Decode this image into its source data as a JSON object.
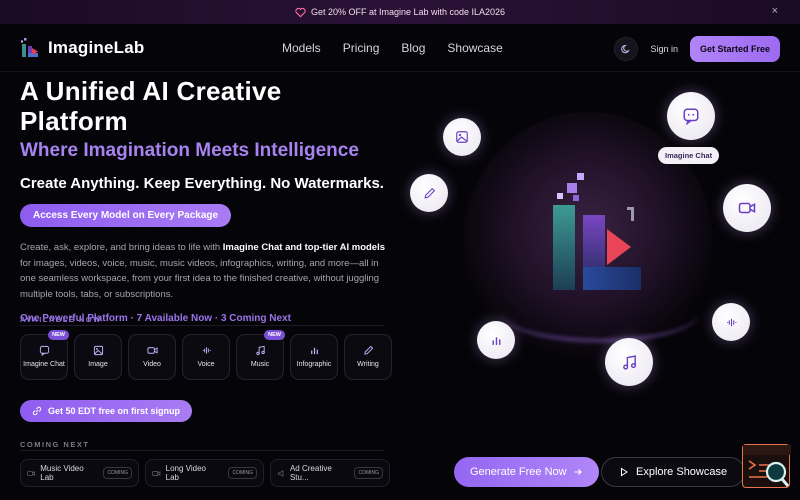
{
  "promo": {
    "text": "Get 20% OFF at Imagine Lab with code ILA2026",
    "close": "×"
  },
  "nav": {
    "logo": "ImagineLab",
    "menu": [
      "Models",
      "Pricing",
      "Blog",
      "Showcase"
    ],
    "sign_in": "Sign in",
    "get_started": "Get Started Free"
  },
  "hero": {
    "title": "A Unified AI Creative Platform",
    "subtitle": "Where Imagination Meets Intelligence",
    "tagline": "Create Anything. Keep Everything. No Watermarks.",
    "pill": "Access Every Model on Every Package",
    "desc_1": "Create, ask, explore, and bring ideas to life with ",
    "desc_bold": "Imagine Chat and top-tier AI models",
    "desc_2": " for images, videos, voice, music, music videos, infographics, writing, and more—all in one seamless workspace, from your first idea to the finished creative, without juggling multiple tools, tabs, or subscriptions.",
    "platform_line": "One Powerful Platform · 7 Available Now · 3 Coming Next"
  },
  "available": {
    "heading": "AVAILABLE NOW",
    "items": [
      {
        "label": "Imagine Chat",
        "badge": "NEW",
        "icon": "chat-icon"
      },
      {
        "label": "Image",
        "badge": "",
        "icon": "image-icon"
      },
      {
        "label": "Video",
        "badge": "",
        "icon": "video-icon"
      },
      {
        "label": "Voice",
        "badge": "",
        "icon": "voice-icon"
      },
      {
        "label": "Music",
        "badge": "NEW",
        "icon": "music-icon"
      },
      {
        "label": "Infographic",
        "badge": "",
        "icon": "chart-icon"
      },
      {
        "label": "Writing",
        "badge": "",
        "icon": "pen-icon"
      }
    ]
  },
  "signup": "Get 50 EDT free on first signup",
  "coming": {
    "heading": "COMING NEXT",
    "items": [
      {
        "label": "Music Video Lab",
        "badge": "COMING"
      },
      {
        "label": "Long Video Lab",
        "badge": "COMING"
      },
      {
        "label": "Ad Creative Stu...",
        "badge": "COMING"
      }
    ]
  },
  "stage": {
    "chat_label": "Imagine Chat"
  },
  "buttons": {
    "generate": "Generate Free Now",
    "explore": "Explore Showcase"
  },
  "colors": {
    "accent": "#9d6af2",
    "accent_text": "#a783f0",
    "promo_bg": "#2a1236"
  }
}
